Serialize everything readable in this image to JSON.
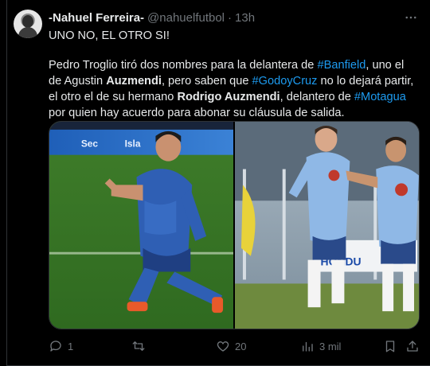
{
  "header": {
    "display_name": "-Nahuel Ferreira-",
    "handle": "@nahuelfutbol",
    "separator": "·",
    "time": "13h"
  },
  "body": {
    "headline": "UNO NO, EL OTRO SI!",
    "p2": {
      "t1": "Pedro Troglio tiró dos nombres para la delantera de ",
      "tag1": "#Banfield",
      "t2": ", uno el de Agustin ",
      "b1": "Auzmendi",
      "t3": ", pero saben que ",
      "tag2": "#GodoyCruz",
      "t4": " no lo dejará partir, el otro el de su hermano ",
      "b2": "Rodrigo Auzmendi",
      "t5": ", delantero de ",
      "tag3": "#Motagua",
      "t6": " por quien hay acuerdo para abonar su cláusula de salida."
    }
  },
  "media": {
    "left_photo_icon": "player-celebration-photo",
    "right_photo_icon": "players-celebration-photo"
  },
  "actions": {
    "replies": "1",
    "reposts": "",
    "likes": "20",
    "views": "3 mil"
  },
  "colors": {
    "background": "#000000",
    "text": "#e7e9ea",
    "muted": "#71767b",
    "link": "#1d9bf0"
  }
}
